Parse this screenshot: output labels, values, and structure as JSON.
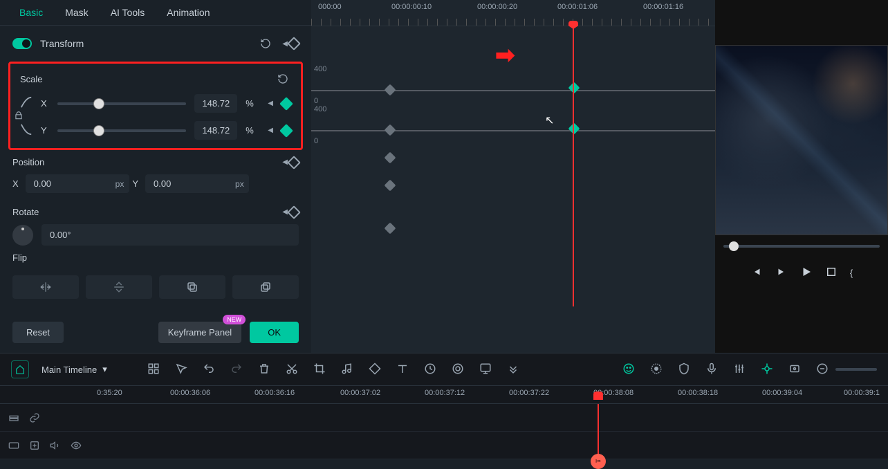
{
  "tabs": {
    "basic": "Basic",
    "mask": "Mask",
    "ai": "AI Tools",
    "animation": "Animation"
  },
  "transform": {
    "label": "Transform"
  },
  "scale": {
    "label": "Scale",
    "x_label": "X",
    "x_value": "148.72",
    "x_unit": "%",
    "y_label": "Y",
    "y_value": "148.72",
    "y_unit": "%"
  },
  "position": {
    "label": "Position",
    "x_label": "X",
    "x_value": "0.00",
    "x_unit": "px",
    "y_label": "Y",
    "y_value": "0.00",
    "y_unit": "px"
  },
  "rotate": {
    "label": "Rotate",
    "value": "0.00°"
  },
  "flip": {
    "label": "Flip"
  },
  "buttons": {
    "reset": "Reset",
    "keyframe_panel": "Keyframe Panel",
    "new_badge": "NEW",
    "ok": "OK"
  },
  "ruler_upper": [
    "000:00",
    "00:00:00:10",
    "00:00:00:20",
    "00:00:01:06",
    "00:00:01:16"
  ],
  "graph_labels": {
    "l400a": "400",
    "l400b": "400",
    "l0a": "0",
    "l0b": "0"
  },
  "timeline": {
    "title": "Main Timeline",
    "marks": [
      "0:35:20",
      "00:00:36:06",
      "00:00:36:16",
      "00:00:37:02",
      "00:00:37:12",
      "00:00:37:22",
      "00:00:38:08",
      "00:00:38:18",
      "00:00:39:04",
      "00:00:39:1"
    ]
  },
  "colors": {
    "accent": "#00c8a0",
    "danger": "#ff3030"
  }
}
